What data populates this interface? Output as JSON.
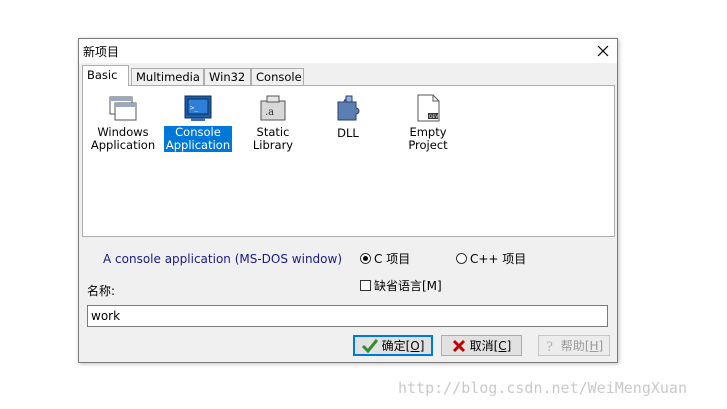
{
  "window": {
    "title": "新项目"
  },
  "tabs": [
    {
      "label": "Basic",
      "active": true
    },
    {
      "label": "Multimedia",
      "active": false
    },
    {
      "label": "Win32",
      "active": false
    },
    {
      "label": "Console",
      "active": false
    }
  ],
  "items": [
    {
      "label_line1": "Windows",
      "label_line2": "Application",
      "icon": "window-app-icon",
      "selected": false
    },
    {
      "label_line1": "Console",
      "label_line2": "Application",
      "icon": "console-app-icon",
      "selected": true
    },
    {
      "label_line1": "Static Library",
      "label_line2": "",
      "icon": "static-library-icon",
      "selected": false
    },
    {
      "label_line1": "DLL",
      "label_line2": "",
      "icon": "dll-puzzle-icon",
      "selected": false
    },
    {
      "label_line1": "Empty Project",
      "label_line2": "",
      "icon": "empty-project-icon",
      "selected": false
    }
  ],
  "description": "A console application (MS-DOS window)",
  "radios": [
    {
      "label": "C 项目",
      "checked": true
    },
    {
      "label": "C++ 项目",
      "checked": false
    }
  ],
  "checkbox": {
    "label": "缺省语言[M]",
    "checked": false
  },
  "name": {
    "label": "名称:",
    "value": "work"
  },
  "buttons": {
    "ok": {
      "label": "确定",
      "accel": "[O]"
    },
    "cancel": {
      "label": "取消",
      "accel": "[C]"
    },
    "help": {
      "label": "帮助",
      "accel": "[H]"
    }
  },
  "watermark": "http://blog.csdn.net/WeiMengXuan",
  "colors": {
    "selection": "#0078d7",
    "description_text": "#1a1a8c",
    "ok_check": "#2e8b2e",
    "cancel_x": "#c00000"
  }
}
